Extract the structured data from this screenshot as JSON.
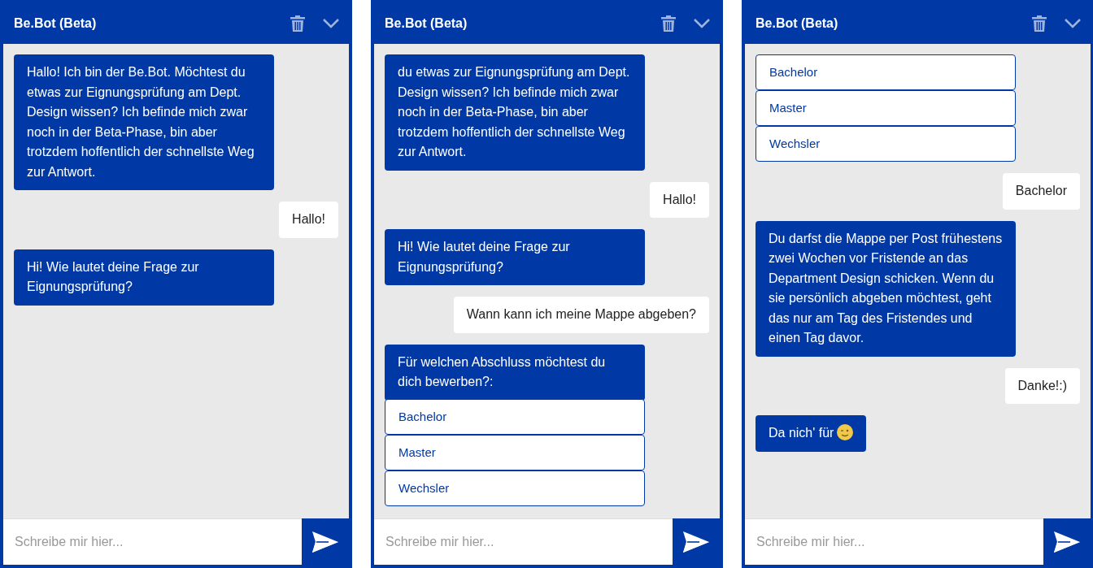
{
  "panels": [
    {
      "header_title": "Be.Bot (Beta)",
      "placeholder": "Schreibe mir hier...",
      "messages": [
        {
          "kind": "bot",
          "text": "Hallo! Ich bin der Be.Bot. Möchtest du etwas zur Eignungsprüfung am Dept. Design wissen? Ich befinde mich zwar noch in der Beta-Phase, bin aber trotzdem hoffentlich der schnellste Weg zur Antwort."
        },
        {
          "kind": "user",
          "text": "Hallo!"
        },
        {
          "kind": "bot",
          "text": "Hi! Wie lautet deine Frage zur Eignungsprüfung?"
        }
      ]
    },
    {
      "header_title": "Be.Bot (Beta)",
      "placeholder": "Schreibe mir hier...",
      "messages": [
        {
          "kind": "bot",
          "text": "du etwas zur Eignungsprüfung am Dept. Design wissen? Ich befinde mich zwar noch in der Beta-Phase, bin aber trotzdem hoffentlich der schnellste Weg zur Antwort."
        },
        {
          "kind": "user",
          "text": "Hallo!"
        },
        {
          "kind": "bot",
          "text": "Hi! Wie lautet deine Frage zur Eignungsprüfung?"
        },
        {
          "kind": "user",
          "text": "Wann kann ich meine Mappe abgeben?"
        },
        {
          "kind": "bot",
          "text": "Für welchen Abschluss möchtest du dich bewerben?:"
        },
        {
          "kind": "option",
          "text": "Bachelor"
        },
        {
          "kind": "option",
          "text": "Master"
        },
        {
          "kind": "option",
          "text": "Wechsler"
        }
      ]
    },
    {
      "header_title": "Be.Bot (Beta)",
      "placeholder": "Schreibe mir hier...",
      "messages": [
        {
          "kind": "option",
          "text": "Bachelor"
        },
        {
          "kind": "option",
          "text": "Master"
        },
        {
          "kind": "option",
          "text": "Wechsler"
        },
        {
          "kind": "user",
          "text": "Bachelor"
        },
        {
          "kind": "bot",
          "text": "Du darfst die Mappe per Post frühestens zwei Wochen vor Fristende an das Department Design schicken. Wenn du sie persönlich abgeben möchtest, geht das nur am Tag des Fristendes und einen Tag davor."
        },
        {
          "kind": "user",
          "text": "Danke!:)"
        },
        {
          "kind": "bot",
          "text": "Da nich' für",
          "has_icon": true
        }
      ]
    }
  ]
}
